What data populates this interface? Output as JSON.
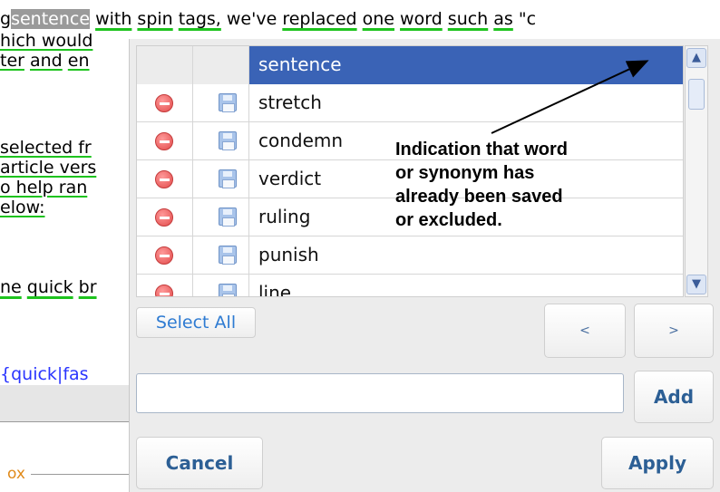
{
  "article": {
    "line1_prefix": "g",
    "line1_highlight": "sentence",
    "line1_w1": "with",
    "line1_w2": "spin",
    "line1_w3": "tags,",
    "line1_w4": "we've",
    "line1_w5": "replaced",
    "line1_w6": "one",
    "line1_w7": "word",
    "line1_w8": "such",
    "line1_w9": "as",
    "line1_tail": "\"c",
    "line2": "hich would",
    "line3a": "ter",
    "line3b": "and",
    "line3c": "en",
    "line4": "selected fr",
    "line5": "article vers",
    "line6": "o help ran",
    "line7": "elow:",
    "line8a": "ne",
    "line8b": "quick",
    "line8c": "br",
    "line9": "{quick|fas",
    "line10": "ox"
  },
  "popup": {
    "header_word": "sentence",
    "synonyms": [
      "stretch",
      "condemn",
      "verdict",
      "ruling",
      "punish",
      "line"
    ],
    "select_all_label": "Select All",
    "prev_label": "<",
    "next_label": ">",
    "input_value": "",
    "add_label": "Add",
    "cancel_label": "Cancel",
    "apply_label": "Apply",
    "scroll_up_icon": "chevron-up-icon",
    "scroll_down_icon": "chevron-down-icon"
  },
  "annotation": {
    "line1": "Indication that word",
    "line2": "or synonym has",
    "line3": "already been saved",
    "line4": "or excluded."
  },
  "colors": {
    "header_bg": "#3a63b6",
    "status_dot": "#e33c1c",
    "underline": "#1ec31e",
    "link_blue": "#2e7bd2"
  }
}
